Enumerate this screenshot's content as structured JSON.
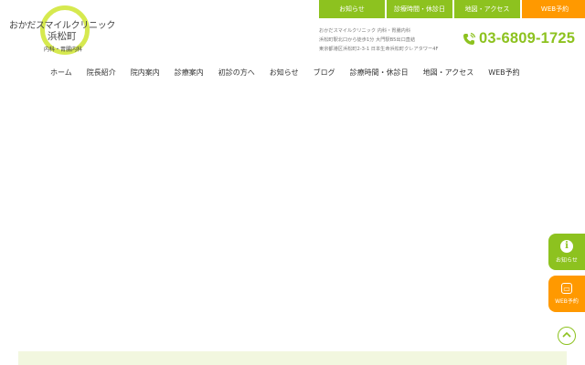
{
  "logo": {
    "name": "おかだスマイルクリニック",
    "area": "浜松町",
    "subtitle": "内科・胃腸内科"
  },
  "top_tabs": [
    {
      "label": "お知らせ"
    },
    {
      "label": "診療時間・休診日"
    },
    {
      "label": "地図・アクセス"
    },
    {
      "label": "WEB予約"
    }
  ],
  "info": {
    "line1": "おかだスマイルクリニック 内科・胃腸内科",
    "line2": "浜松町駅北口から徒歩1分 大門駅B5出口直結",
    "line3": "東京都港区浜松町2-3-1 日本生命浜松町クレアタワー4F"
  },
  "phone": {
    "number": "03-6809-1725",
    "icon": "phone-icon"
  },
  "main_nav": [
    {
      "label": "ホーム"
    },
    {
      "label": "院長紹介"
    },
    {
      "label": "院内案内"
    },
    {
      "label": "診療案内"
    },
    {
      "label": "初診の方へ"
    },
    {
      "label": "お知らせ"
    },
    {
      "label": "ブログ"
    },
    {
      "label": "診療時間・休診日"
    },
    {
      "label": "地図・アクセス"
    },
    {
      "label": "WEB予約"
    }
  ],
  "side": {
    "news_label": "お知らせ",
    "web_label": "WEB予約"
  },
  "colors": {
    "accent": "#8dc21f",
    "reserve": "#ff9900",
    "logo_ring": "#d6e94f"
  }
}
